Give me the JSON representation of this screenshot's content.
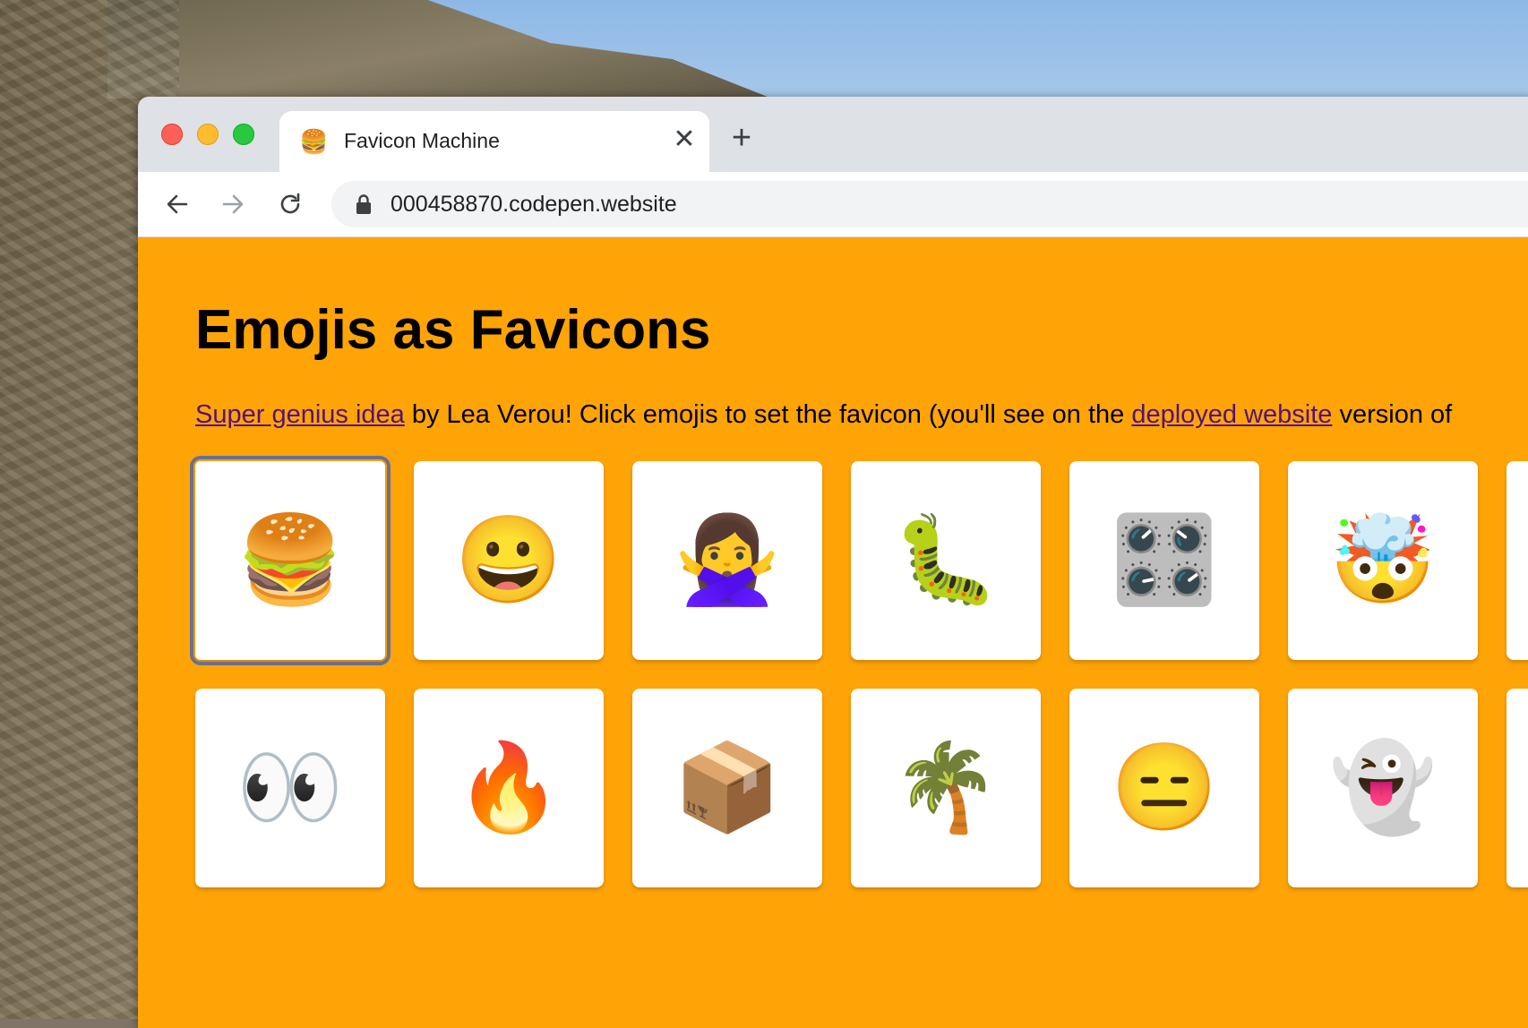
{
  "tab": {
    "favicon": "🍔",
    "title": "Favicon Machine",
    "close_label": "✕",
    "new_tab_label": "+"
  },
  "toolbar": {
    "url": "000458870.codepen.website"
  },
  "page": {
    "heading": "Emojis as Favicons",
    "intro_link1": "Super genius idea",
    "intro_text1": " by Lea Verou! Click emojis to set the favicon (you'll see on the ",
    "intro_link2": "deployed website",
    "intro_text2": " version of"
  },
  "emojis": {
    "row1": [
      "🍔",
      "😀",
      "🙅‍♀️",
      "🐛",
      "🎛️",
      "🤯",
      ""
    ],
    "row2": [
      "👀",
      "🔥",
      "📦",
      "🌴",
      "😑",
      "👻",
      ""
    ]
  },
  "colors": {
    "page_background": "#ffa407",
    "link": "#55117a",
    "selected_outline": "#6b6f93"
  }
}
